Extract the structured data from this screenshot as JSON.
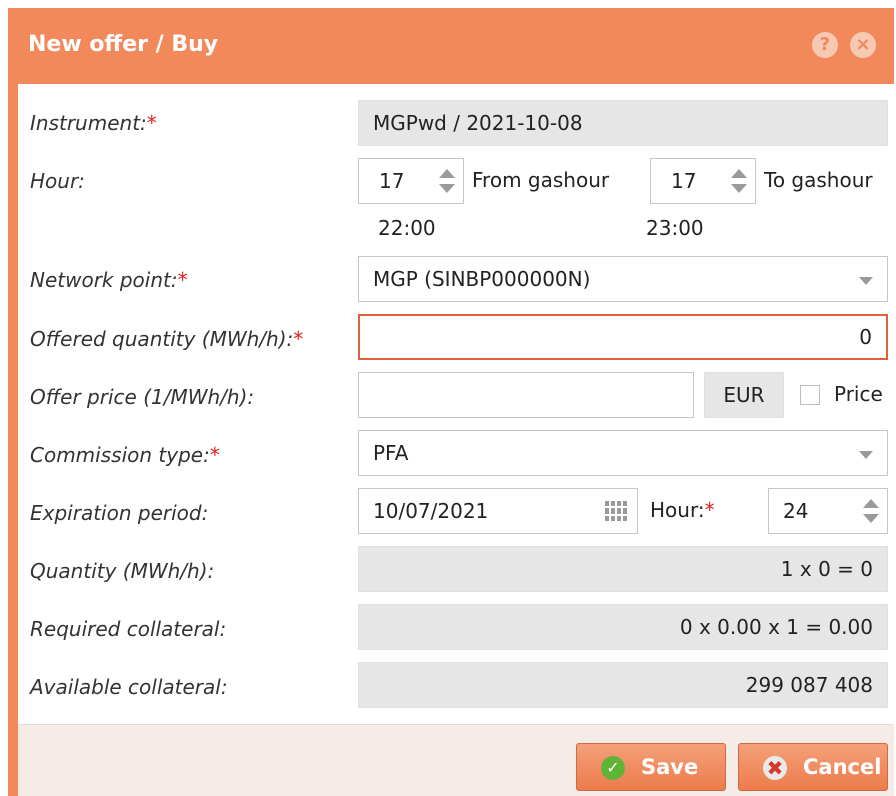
{
  "dialog": {
    "title": "New offer / Buy",
    "help_icon": "help-icon",
    "close_icon": "close-icon"
  },
  "form": {
    "instrument": {
      "label": "Instrument:",
      "required": "*",
      "value": "MGPwd / 2021-10-08"
    },
    "hour": {
      "label": "Hour:",
      "from_value": "17",
      "from_label": "From gashour",
      "from_time": "22:00",
      "to_value": "17",
      "to_label": "To gashour",
      "to_time": "23:00"
    },
    "network_point": {
      "label": "Network point:",
      "required": "*",
      "value": "MGP (SINBP000000N)"
    },
    "offered_quantity": {
      "label": "Offered quantity (MWh/h):",
      "required": "*",
      "value": "0"
    },
    "offer_price": {
      "label": "Offer price (1/MWh/h):",
      "value": "",
      "currency": "EUR",
      "checkbox_label": "Price"
    },
    "commission_type": {
      "label": "Commission type:",
      "required": "*",
      "value": "PFA"
    },
    "expiration": {
      "label": "Expiration period:",
      "date": "10/07/2021",
      "hour_label": "Hour:",
      "hour_required": "*",
      "hour_value": "24"
    },
    "quantity": {
      "label": "Quantity (MWh/h):",
      "value": "1 x 0 = 0"
    },
    "required_collateral": {
      "label": "Required collateral:",
      "value": "0 x 0.00 x 1 = 0.00"
    },
    "available_collateral": {
      "label": "Available collateral:",
      "value": "299 087 408"
    }
  },
  "footer": {
    "save_label": "Save",
    "cancel_label": "Cancel"
  },
  "colors": {
    "accent": "#f2895a",
    "required": "#e02020",
    "error_border": "#e0603c"
  }
}
